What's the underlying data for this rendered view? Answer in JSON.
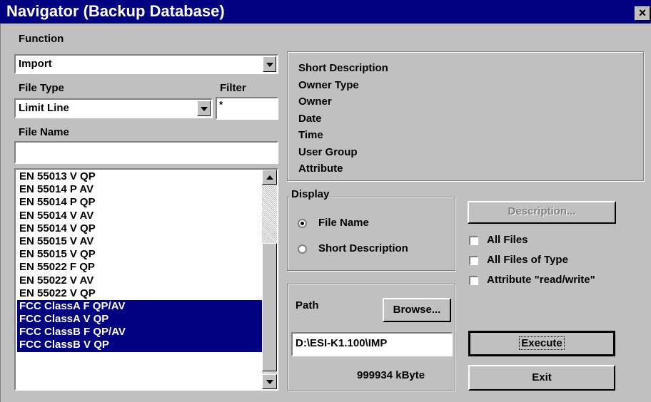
{
  "window": {
    "title": "Navigator (Backup Database)",
    "close_glyph": "×"
  },
  "function": {
    "label": "Function",
    "value": "Import"
  },
  "file_type": {
    "label": "File Type",
    "value": "Limit Line"
  },
  "filter": {
    "label": "Filter",
    "value": "*"
  },
  "file_name": {
    "label": "File Name",
    "value": ""
  },
  "file_list": {
    "items": [
      {
        "label": "EN 55013 V QP",
        "selected": false
      },
      {
        "label": "EN 55014 P AV",
        "selected": false
      },
      {
        "label": "EN 55014 P QP",
        "selected": false
      },
      {
        "label": "EN 55014 V AV",
        "selected": false
      },
      {
        "label": "EN 55014 V QP",
        "selected": false
      },
      {
        "label": "EN 55015 V AV",
        "selected": false
      },
      {
        "label": "EN 55015 V QP",
        "selected": false
      },
      {
        "label": "EN 55022 F QP",
        "selected": false
      },
      {
        "label": "EN 55022 V AV",
        "selected": false
      },
      {
        "label": "EN 55022 V QP",
        "selected": false
      },
      {
        "label": "FCC ClassA F QP/AV",
        "selected": true
      },
      {
        "label": "FCC ClassA V QP",
        "selected": true
      },
      {
        "label": "FCC ClassB F QP/AV",
        "selected": true
      },
      {
        "label": "FCC ClassB V QP",
        "selected": true
      }
    ]
  },
  "info_panel": {
    "fields": [
      "Short Description",
      "Owner Type",
      "Owner",
      "Date",
      "Time",
      "User Group",
      "Attribute"
    ]
  },
  "display": {
    "label": "Display",
    "options": [
      {
        "label": "File Name",
        "checked": true
      },
      {
        "label": "Short Description",
        "checked": false
      }
    ]
  },
  "buttons": {
    "description": "Description...",
    "browse": "Browse...",
    "execute": "Execute",
    "exit": "Exit"
  },
  "checkboxes": [
    {
      "label": "All Files",
      "checked": false
    },
    {
      "label": "All Files of Type",
      "checked": false
    },
    {
      "label": "Attribute \"read/write\"",
      "checked": false
    }
  ],
  "path": {
    "label": "Path",
    "value": "D:\\ESI-K1.100\\IMP",
    "free_space": "999934 kByte"
  },
  "colors": {
    "titlebar": "#000080",
    "selection": "#000080",
    "face": "#c0c0c0"
  }
}
